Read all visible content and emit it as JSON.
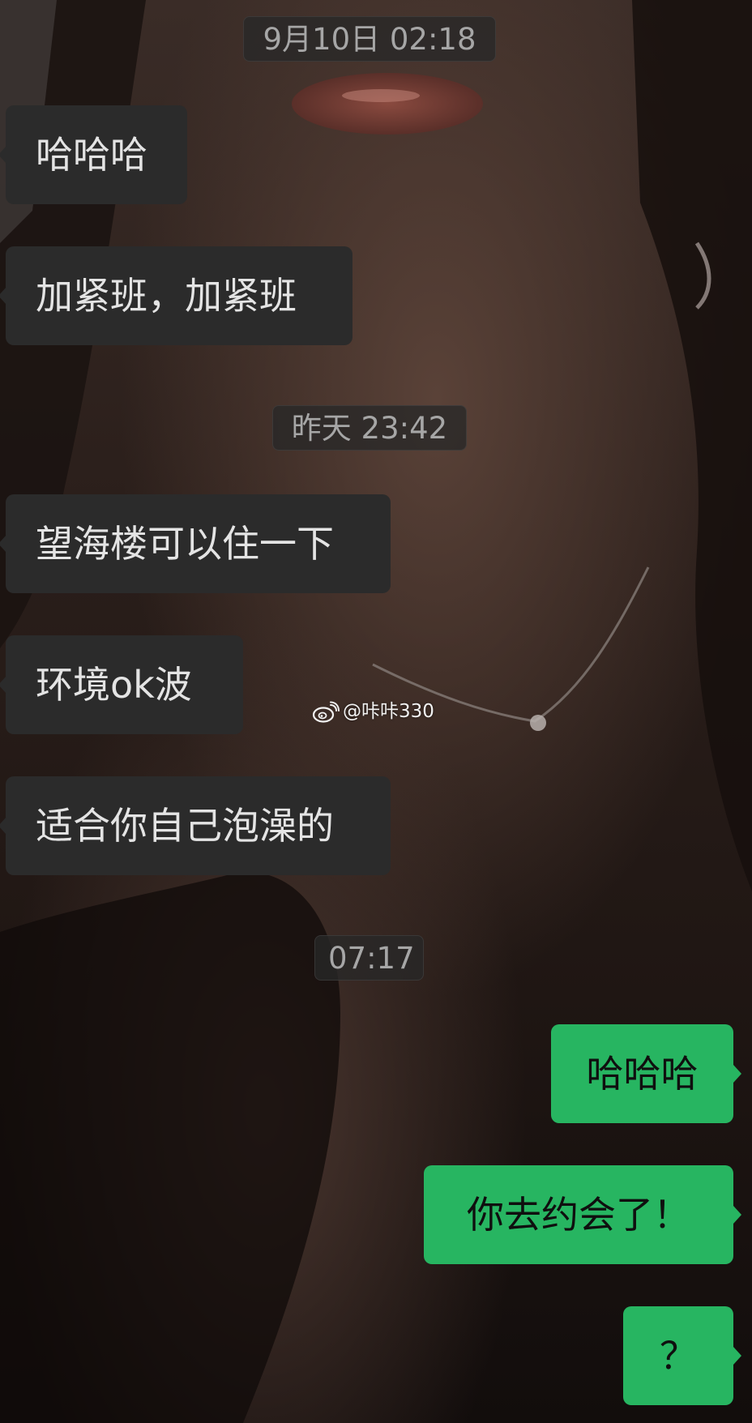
{
  "timestamps": {
    "first": "9月10日 02:18",
    "second": "昨天 23:42",
    "third": "07:17"
  },
  "messages": {
    "incoming": [
      "哈哈哈",
      "加紧班，加紧班",
      "望海楼可以住一下",
      "环境ok波",
      "适合你自己泡澡的"
    ],
    "outgoing": [
      "哈哈哈",
      "你去约会了！",
      "？"
    ]
  },
  "watermark": {
    "icon": "weibo-icon",
    "text": "@咔咔330"
  },
  "colors": {
    "incoming_bubble": "#2b2b2b",
    "outgoing_bubble": "#27b561",
    "timestamp_text": "#a6a6a6"
  }
}
